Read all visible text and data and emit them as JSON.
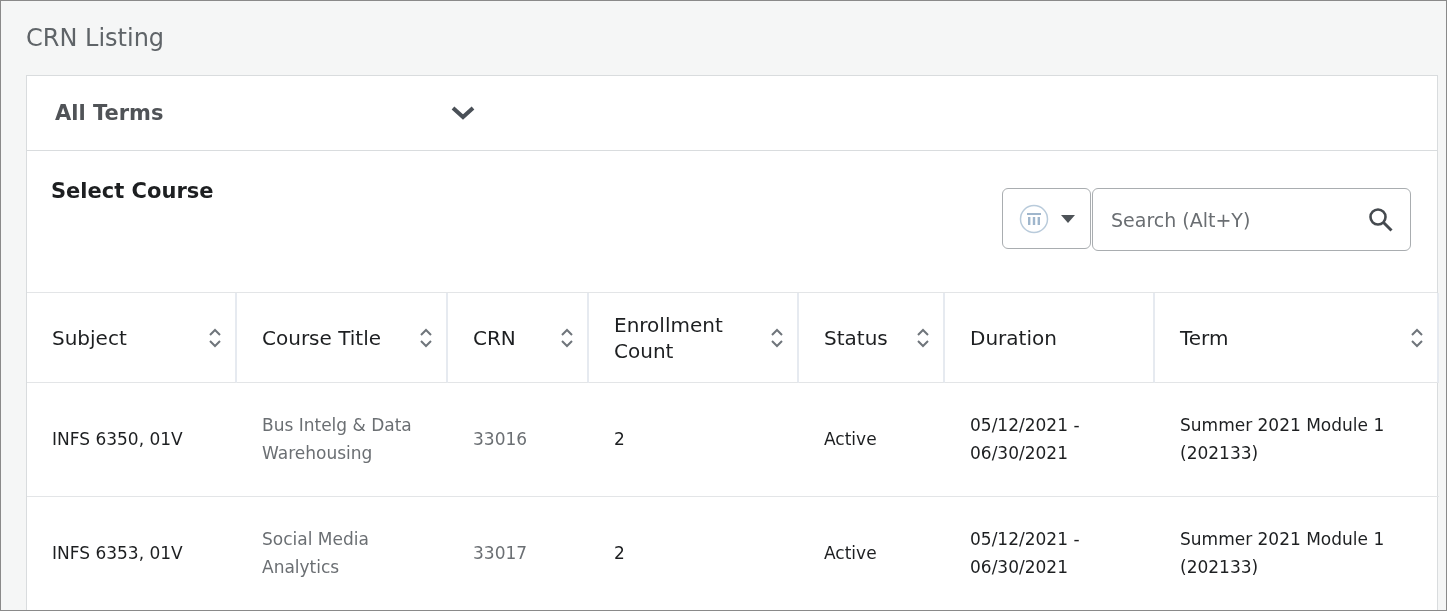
{
  "title": "CRN Listing",
  "term_select": {
    "value": "All Terms"
  },
  "section_title": "Select Course",
  "search": {
    "placeholder": "Search (Alt+Y)"
  },
  "table": {
    "columns": [
      {
        "label": "Subject",
        "sortable": true,
        "kind": "text"
      },
      {
        "label": "Course Title",
        "sortable": true,
        "kind": "link"
      },
      {
        "label": "CRN",
        "sortable": true,
        "kind": "link"
      },
      {
        "label": "Enrollment Count",
        "sortable": true,
        "kind": "text"
      },
      {
        "label": "Status",
        "sortable": true,
        "kind": "text"
      },
      {
        "label": "Duration",
        "sortable": false,
        "kind": "text"
      },
      {
        "label": "Term",
        "sortable": true,
        "kind": "text"
      }
    ],
    "rows": [
      [
        "INFS 6350, 01V",
        "Bus Intelg & Data Warehousing",
        "33016",
        "2",
        "Active",
        "05/12/2021 - 06/30/2021",
        "Summer 2021 Module 1 (202133)"
      ],
      [
        "INFS 6353, 01V",
        "Social Media Analytics",
        "33017",
        "2",
        "Active",
        "05/12/2021 - 06/30/2021",
        "Summer 2021 Module 1 (202133)"
      ]
    ]
  }
}
